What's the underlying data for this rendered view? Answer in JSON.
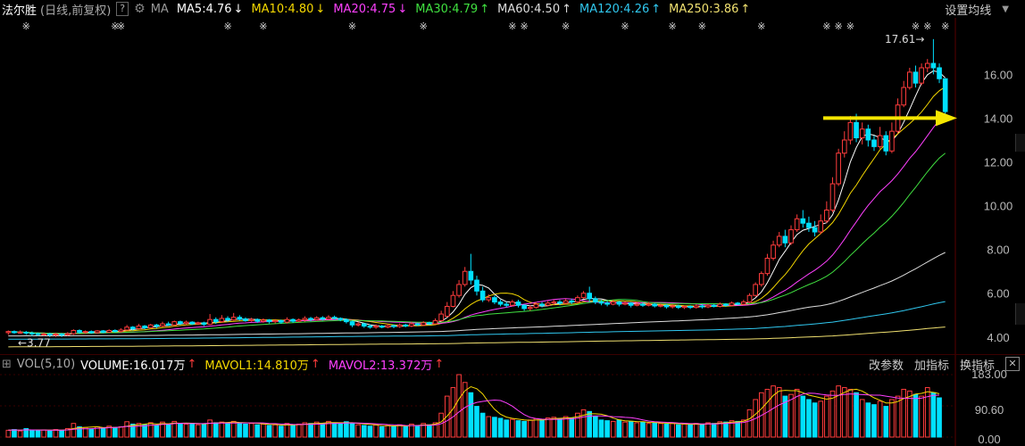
{
  "header": {
    "stock_name": "法尔胜",
    "period": "(日线,前复权)",
    "help_btn": "?",
    "ma_label": "MA",
    "settings_label": "设置均线",
    "ma_items": [
      {
        "text": "MA5:4.76",
        "arrow": "↓",
        "color": "#ffffff"
      },
      {
        "text": "MA10:4.80",
        "arrow": "↓",
        "color": "#f5d800"
      },
      {
        "text": "MA20:4.75",
        "arrow": "↓",
        "color": "#ff40ff"
      },
      {
        "text": "MA30:4.79",
        "arrow": "↑",
        "color": "#40e040"
      },
      {
        "text": "MA60:4.50",
        "arrow": "↑",
        "color": "#dddddd"
      },
      {
        "text": "MA120:4.26",
        "arrow": "↑",
        "color": "#30c8f0"
      },
      {
        "text": "MA250:3.86",
        "arrow": "↑",
        "color": "#f0e070"
      }
    ]
  },
  "price_axis": [
    "16.00",
    "14.00",
    "12.00",
    "10.00",
    "8.00",
    "6.00",
    "4.00"
  ],
  "annotations": {
    "high": "17.61",
    "high_arrow": "→",
    "low": "3.77",
    "low_arrow": "←"
  },
  "volume_header": {
    "toggle": "⊞",
    "indicator": "VOL(5,10)",
    "volume": "VOLUME:16.017万",
    "volume_arrow": "↑",
    "mavol1": "MAVOL1:14.810万",
    "mavol1_arrow": "↑",
    "mavol2": "MAVOL2:13.372万",
    "mavol2_arrow": "↑",
    "tools": [
      "改参数",
      "加指标",
      "换指标"
    ],
    "close": "✕"
  },
  "volume_axis": [
    "183.00",
    "90.60",
    "0.00"
  ],
  "colors": {
    "up": "#ff3c3c",
    "down": "#00e0ff",
    "arrow": "#f5e600"
  },
  "chart_data": {
    "type": "candlestick",
    "title": "法尔胜",
    "period": "日线,前复权",
    "ylim": [
      3.3,
      18.5
    ],
    "yticks": [
      4,
      6,
      8,
      10,
      12,
      14,
      16
    ],
    "annotations": {
      "max": 17.61,
      "min": 3.77
    },
    "candles": [
      [
        4.2,
        4.25,
        4.1,
        4.3
      ],
      [
        4.25,
        4.2,
        4.15,
        4.3
      ],
      [
        4.2,
        4.22,
        4.15,
        4.3
      ],
      [
        4.22,
        4.18,
        4.1,
        4.28
      ],
      [
        4.18,
        4.15,
        4.05,
        4.25
      ],
      [
        4.15,
        4.12,
        4.05,
        4.2
      ],
      [
        4.12,
        4.14,
        4.05,
        4.2
      ],
      [
        4.14,
        4.1,
        4.0,
        4.2
      ],
      [
        4.1,
        4.13,
        4.0,
        4.2
      ],
      [
        4.13,
        4.1,
        4.0,
        4.18
      ],
      [
        4.1,
        4.15,
        4.05,
        4.22
      ],
      [
        4.15,
        4.3,
        4.1,
        4.35
      ],
      [
        4.3,
        4.22,
        4.15,
        4.35
      ],
      [
        4.22,
        4.25,
        4.15,
        4.3
      ],
      [
        4.25,
        4.2,
        4.15,
        4.3
      ],
      [
        4.2,
        4.28,
        4.15,
        4.32
      ],
      [
        4.28,
        4.22,
        4.18,
        4.32
      ],
      [
        4.22,
        4.3,
        4.2,
        4.35
      ],
      [
        4.3,
        4.25,
        4.2,
        4.35
      ],
      [
        4.25,
        4.32,
        4.2,
        4.4
      ],
      [
        4.32,
        4.45,
        4.3,
        4.55
      ],
      [
        4.45,
        4.38,
        4.3,
        4.5
      ],
      [
        4.38,
        4.5,
        4.35,
        4.6
      ],
      [
        4.5,
        4.42,
        4.35,
        4.55
      ],
      [
        4.42,
        4.55,
        4.4,
        4.6
      ],
      [
        4.55,
        4.5,
        4.4,
        4.6
      ],
      [
        4.5,
        4.6,
        4.45,
        4.7
      ],
      [
        4.6,
        4.55,
        4.5,
        4.7
      ],
      [
        4.55,
        4.7,
        4.5,
        4.75
      ],
      [
        4.7,
        4.62,
        4.55,
        4.75
      ],
      [
        4.62,
        4.68,
        4.55,
        4.75
      ],
      [
        4.68,
        4.6,
        4.55,
        4.72
      ],
      [
        4.6,
        4.65,
        4.55,
        4.7
      ],
      [
        4.65,
        4.58,
        4.5,
        4.7
      ],
      [
        4.58,
        4.8,
        4.55,
        5.05
      ],
      [
        4.8,
        4.7,
        4.6,
        4.9
      ],
      [
        4.7,
        4.85,
        4.65,
        5.0
      ],
      [
        4.85,
        4.78,
        4.7,
        4.95
      ],
      [
        4.78,
        4.9,
        4.75,
        5.1
      ],
      [
        4.9,
        4.82,
        4.75,
        5.0
      ],
      [
        4.82,
        4.75,
        4.7,
        4.9
      ],
      [
        4.75,
        4.8,
        4.7,
        4.88
      ],
      [
        4.8,
        4.72,
        4.65,
        4.85
      ],
      [
        4.72,
        4.78,
        4.65,
        4.85
      ],
      [
        4.78,
        4.7,
        4.62,
        4.82
      ],
      [
        4.7,
        4.75,
        4.62,
        4.82
      ],
      [
        4.75,
        4.68,
        4.6,
        4.8
      ],
      [
        4.68,
        4.8,
        4.62,
        4.9
      ],
      [
        4.8,
        4.72,
        4.65,
        4.85
      ],
      [
        4.72,
        4.78,
        4.68,
        4.85
      ],
      [
        4.78,
        4.85,
        4.7,
        4.95
      ],
      [
        4.85,
        4.8,
        4.72,
        4.92
      ],
      [
        4.8,
        4.88,
        4.75,
        4.95
      ],
      [
        4.88,
        4.82,
        4.75,
        4.95
      ],
      [
        4.82,
        4.9,
        4.78,
        5.0
      ],
      [
        4.9,
        4.85,
        4.78,
        4.98
      ],
      [
        4.85,
        4.8,
        4.72,
        4.9
      ],
      [
        4.8,
        4.7,
        4.62,
        4.85
      ],
      [
        4.7,
        4.55,
        4.45,
        4.75
      ],
      [
        4.55,
        4.6,
        4.48,
        4.7
      ],
      [
        4.6,
        4.5,
        4.42,
        4.65
      ],
      [
        4.5,
        4.45,
        4.38,
        4.58
      ],
      [
        4.45,
        4.5,
        4.38,
        4.58
      ],
      [
        4.5,
        4.45,
        4.4,
        4.55
      ],
      [
        4.45,
        4.52,
        4.4,
        4.6
      ],
      [
        4.52,
        4.48,
        4.4,
        4.58
      ],
      [
        4.48,
        4.55,
        4.42,
        4.62
      ],
      [
        4.55,
        4.5,
        4.45,
        4.6
      ],
      [
        4.5,
        4.6,
        4.45,
        4.7
      ],
      [
        4.6,
        4.55,
        4.5,
        4.65
      ],
      [
        4.55,
        4.65,
        4.5,
        4.72
      ],
      [
        4.65,
        4.6,
        4.55,
        4.7
      ],
      [
        4.6,
        4.75,
        4.58,
        4.85
      ],
      [
        4.75,
        5.05,
        4.7,
        5.2
      ],
      [
        4.95,
        5.4,
        4.9,
        5.6
      ],
      [
        5.4,
        5.9,
        5.35,
        6.1
      ],
      [
        5.9,
        6.4,
        5.8,
        6.6
      ],
      [
        6.4,
        7.0,
        6.3,
        7.2
      ],
      [
        7.0,
        6.6,
        6.4,
        7.8
      ],
      [
        6.6,
        6.1,
        5.9,
        6.8
      ],
      [
        6.1,
        5.7,
        5.6,
        6.3
      ],
      [
        5.7,
        5.8,
        5.6,
        5.95
      ],
      [
        5.8,
        5.6,
        5.5,
        5.9
      ],
      [
        5.6,
        5.5,
        5.4,
        5.7
      ],
      [
        5.5,
        5.45,
        5.35,
        5.6
      ],
      [
        5.45,
        5.6,
        5.4,
        5.7
      ],
      [
        5.6,
        5.45,
        5.35,
        5.7
      ],
      [
        5.45,
        5.3,
        5.2,
        5.5
      ],
      [
        5.3,
        5.35,
        5.2,
        5.45
      ],
      [
        5.35,
        5.5,
        5.3,
        5.6
      ],
      [
        5.5,
        5.45,
        5.35,
        5.6
      ],
      [
        5.45,
        5.55,
        5.4,
        5.65
      ],
      [
        5.55,
        5.6,
        5.45,
        5.7
      ],
      [
        5.6,
        5.55,
        5.45,
        5.7
      ],
      [
        5.55,
        5.65,
        5.5,
        5.75
      ],
      [
        5.65,
        5.6,
        5.5,
        5.75
      ],
      [
        5.6,
        5.8,
        5.55,
        5.9
      ],
      [
        5.8,
        6.0,
        5.75,
        6.1
      ],
      [
        6.0,
        5.75,
        5.6,
        6.3
      ],
      [
        5.75,
        5.6,
        5.5,
        5.85
      ],
      [
        5.6,
        5.55,
        5.45,
        5.7
      ],
      [
        5.55,
        5.5,
        5.4,
        5.65
      ],
      [
        5.5,
        5.6,
        5.45,
        5.7
      ],
      [
        5.6,
        5.5,
        5.4,
        5.65
      ],
      [
        5.5,
        5.55,
        5.45,
        5.65
      ],
      [
        5.55,
        5.45,
        5.35,
        5.6
      ],
      [
        5.45,
        5.5,
        5.4,
        5.6
      ],
      [
        5.5,
        5.45,
        5.38,
        5.58
      ],
      [
        5.45,
        5.5,
        5.4,
        5.6
      ],
      [
        5.5,
        5.42,
        5.35,
        5.55
      ],
      [
        5.42,
        5.45,
        5.35,
        5.52
      ],
      [
        5.45,
        5.38,
        5.3,
        5.5
      ],
      [
        5.38,
        5.42,
        5.3,
        5.5
      ],
      [
        5.42,
        5.35,
        5.28,
        5.48
      ],
      [
        5.35,
        5.4,
        5.28,
        5.45
      ],
      [
        5.4,
        5.35,
        5.28,
        5.45
      ],
      [
        5.35,
        5.42,
        5.3,
        5.5
      ],
      [
        5.42,
        5.38,
        5.3,
        5.5
      ],
      [
        5.38,
        5.45,
        5.32,
        5.52
      ],
      [
        5.45,
        5.4,
        5.35,
        5.5
      ],
      [
        5.4,
        5.5,
        5.35,
        5.58
      ],
      [
        5.5,
        5.45,
        5.38,
        5.55
      ],
      [
        5.45,
        5.55,
        5.4,
        5.62
      ],
      [
        5.55,
        5.5,
        5.45,
        5.6
      ],
      [
        5.5,
        5.6,
        5.45,
        5.7
      ],
      [
        5.6,
        5.9,
        5.55,
        6.0
      ],
      [
        5.9,
        6.4,
        5.85,
        6.5
      ],
      [
        6.4,
        6.9,
        6.3,
        7.0
      ],
      [
        6.9,
        7.6,
        6.8,
        7.8
      ],
      [
        7.6,
        8.2,
        7.5,
        8.4
      ],
      [
        8.2,
        8.6,
        8.1,
        8.8
      ],
      [
        8.6,
        8.3,
        8.1,
        8.9
      ],
      [
        8.3,
        8.9,
        8.2,
        9.1
      ],
      [
        8.9,
        9.4,
        8.8,
        9.6
      ],
      [
        9.4,
        9.2,
        9.0,
        9.8
      ],
      [
        9.2,
        9.0,
        8.8,
        9.5
      ],
      [
        9.0,
        8.8,
        8.6,
        9.3
      ],
      [
        8.8,
        9.3,
        8.7,
        9.6
      ],
      [
        9.3,
        9.8,
        9.2,
        10.2
      ],
      [
        9.8,
        11.0,
        9.7,
        11.3
      ],
      [
        11.0,
        12.4,
        10.9,
        12.6
      ],
      [
        12.4,
        13.0,
        12.2,
        13.4
      ],
      [
        13.0,
        13.8,
        12.8,
        14.1
      ],
      [
        13.8,
        13.1,
        12.9,
        14.2
      ],
      [
        13.1,
        13.5,
        12.8,
        13.8
      ],
      [
        13.5,
        13.0,
        12.7,
        13.7
      ],
      [
        13.0,
        12.7,
        12.5,
        13.2
      ],
      [
        12.7,
        13.2,
        12.6,
        13.6
      ],
      [
        13.2,
        12.5,
        12.3,
        13.4
      ],
      [
        12.5,
        13.4,
        12.4,
        13.8
      ],
      [
        13.4,
        14.6,
        13.3,
        14.9
      ],
      [
        14.6,
        15.4,
        14.5,
        15.7
      ],
      [
        15.4,
        16.1,
        15.3,
        16.3
      ],
      [
        16.1,
        15.6,
        15.4,
        16.4
      ],
      [
        15.6,
        16.3,
        15.5,
        16.5
      ],
      [
        16.3,
        16.5,
        16.1,
        16.7
      ],
      [
        16.5,
        16.3,
        16.0,
        17.61
      ],
      [
        16.3,
        15.8,
        15.6,
        16.5
      ],
      [
        15.8,
        14.3,
        14.1,
        15.6
      ]
    ],
    "volume": [
      20,
      22,
      18,
      25,
      20,
      19,
      21,
      18,
      22,
      20,
      25,
      40,
      30,
      28,
      24,
      30,
      26,
      32,
      28,
      30,
      45,
      38,
      40,
      36,
      42,
      35,
      44,
      38,
      46,
      40,
      38,
      40,
      36,
      38,
      50,
      42,
      44,
      40,
      46,
      42,
      38,
      40,
      36,
      38,
      34,
      36,
      32,
      40,
      36,
      38,
      42,
      40,
      44,
      40,
      46,
      42,
      38,
      45,
      40,
      36,
      34,
      32,
      36,
      30,
      34,
      32,
      36,
      30,
      38,
      34,
      40,
      36,
      42,
      70,
      120,
      145,
      183,
      160,
      130,
      90,
      70,
      60,
      58,
      55,
      50,
      52,
      48,
      46,
      50,
      54,
      52,
      56,
      58,
      54,
      60,
      56,
      70,
      80,
      75,
      60,
      50,
      48,
      46,
      50,
      44,
      46,
      42,
      44,
      40,
      42,
      40,
      38,
      40,
      36,
      38,
      36,
      40,
      38,
      42,
      40,
      45,
      44,
      48,
      46,
      50,
      80,
      110,
      130,
      140,
      150,
      145,
      120,
      125,
      140,
      120,
      110,
      100,
      105,
      120,
      135,
      150,
      145,
      140,
      130,
      110,
      100,
      95,
      105,
      90,
      110,
      120,
      140,
      135,
      125,
      120,
      145,
      130,
      115
    ],
    "volume_ylim": [
      0,
      183
    ],
    "ma": {
      "MA5": 4.76,
      "MA10": 4.8,
      "MA20": 4.75,
      "MA30": 4.79,
      "MA60": 4.5,
      "MA120": 4.26,
      "MA250": 3.86
    }
  }
}
